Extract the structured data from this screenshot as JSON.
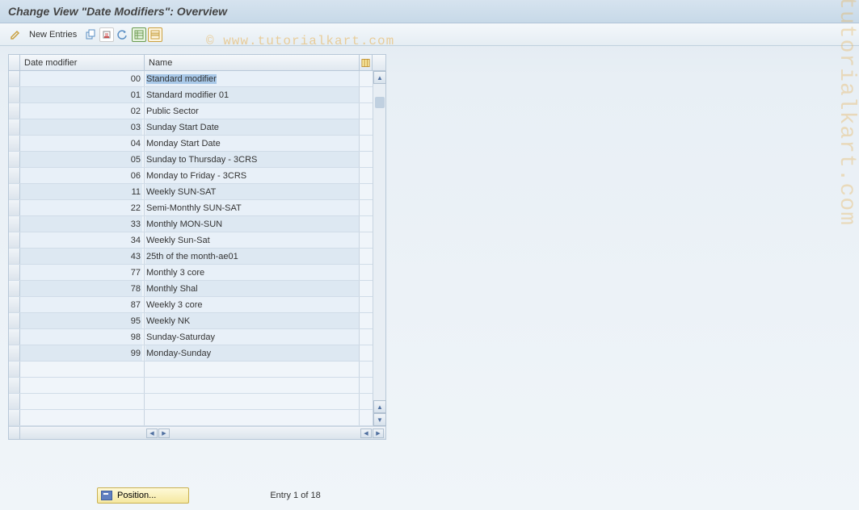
{
  "title": "Change View \"Date Modifiers\": Overview",
  "watermark1": "© www.tutorialkart.com",
  "watermark2": "tutorialkart.com",
  "toolbar": {
    "new_entries": "New Entries"
  },
  "table": {
    "headers": {
      "date_modifier": "Date modifier",
      "name": "Name"
    },
    "rows": [
      {
        "code": "00",
        "name": "Standard modifier",
        "selected": true
      },
      {
        "code": "01",
        "name": "Standard modifier 01",
        "selected": false
      },
      {
        "code": "02",
        "name": "Public Sector",
        "selected": false
      },
      {
        "code": "03",
        "name": "Sunday Start Date",
        "selected": false
      },
      {
        "code": "04",
        "name": "Monday Start Date",
        "selected": false
      },
      {
        "code": "05",
        "name": "Sunday to Thursday - 3CRS",
        "selected": false
      },
      {
        "code": "06",
        "name": "Monday to Friday - 3CRS",
        "selected": false
      },
      {
        "code": "11",
        "name": "Weekly SUN-SAT",
        "selected": false
      },
      {
        "code": "22",
        "name": "Semi-Monthly SUN-SAT",
        "selected": false
      },
      {
        "code": "33",
        "name": "Monthly MON-SUN",
        "selected": false
      },
      {
        "code": "34",
        "name": "Weekly Sun-Sat",
        "selected": false
      },
      {
        "code": "43",
        "name": "25th of the month-ae01",
        "selected": false
      },
      {
        "code": "77",
        "name": "Monthly 3 core",
        "selected": false
      },
      {
        "code": "78",
        "name": "Monthly Shal",
        "selected": false
      },
      {
        "code": "87",
        "name": "Weekly 3 core",
        "selected": false
      },
      {
        "code": "95",
        "name": "Weekly NK",
        "selected": false
      },
      {
        "code": "98",
        "name": "Sunday-Saturday",
        "selected": false
      },
      {
        "code": "99",
        "name": "Monday-Sunday",
        "selected": false
      }
    ],
    "empty_rows": 4
  },
  "footer": {
    "position_label": "Position...",
    "entry_text": "Entry 1 of 18"
  }
}
